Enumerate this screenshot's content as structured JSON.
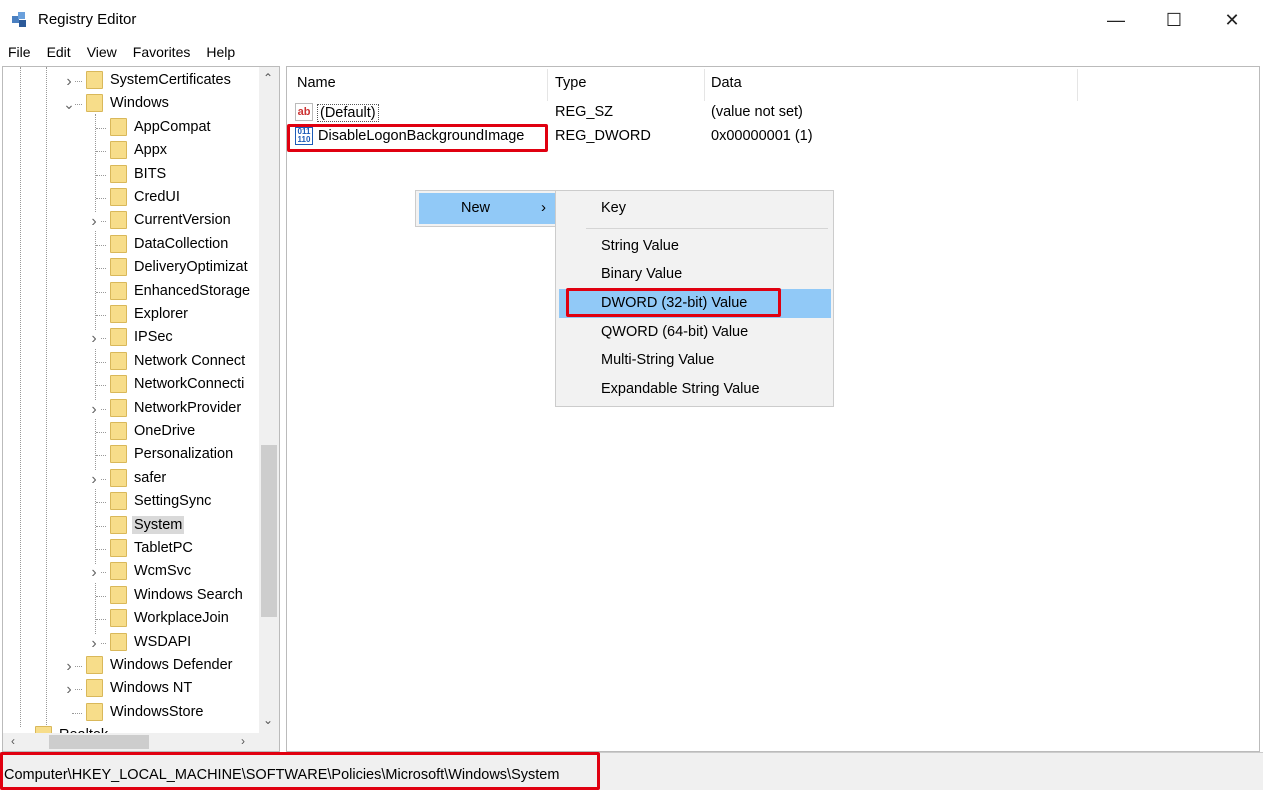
{
  "window": {
    "title": "Registry Editor",
    "minimize": "—",
    "maximize": "☐",
    "close": "✕"
  },
  "menu": [
    "File",
    "Edit",
    "View",
    "Favorites",
    "Help"
  ],
  "tree": {
    "items": [
      {
        "label": "SystemCertificates",
        "level": 1,
        "expander": "collapsed"
      },
      {
        "label": "Windows",
        "level": 1,
        "expander": "expanded"
      },
      {
        "label": "AppCompat",
        "level": 2
      },
      {
        "label": "Appx",
        "level": 2
      },
      {
        "label": "BITS",
        "level": 2
      },
      {
        "label": "CredUI",
        "level": 2
      },
      {
        "label": "CurrentVersion",
        "level": 2,
        "expander": "collapsed"
      },
      {
        "label": "DataCollection",
        "level": 2
      },
      {
        "label": "DeliveryOptimizat",
        "level": 2
      },
      {
        "label": "EnhancedStorage",
        "level": 2
      },
      {
        "label": "Explorer",
        "level": 2
      },
      {
        "label": "IPSec",
        "level": 2,
        "expander": "collapsed"
      },
      {
        "label": "Network Connect",
        "level": 2
      },
      {
        "label": "NetworkConnecti",
        "level": 2
      },
      {
        "label": "NetworkProvider",
        "level": 2,
        "expander": "collapsed"
      },
      {
        "label": "OneDrive",
        "level": 2
      },
      {
        "label": "Personalization",
        "level": 2
      },
      {
        "label": "safer",
        "level": 2,
        "expander": "collapsed"
      },
      {
        "label": "SettingSync",
        "level": 2
      },
      {
        "label": "System",
        "level": 2,
        "selected": true
      },
      {
        "label": "TabletPC",
        "level": 2
      },
      {
        "label": "WcmSvc",
        "level": 2,
        "expander": "collapsed"
      },
      {
        "label": "Windows Search",
        "level": 2
      },
      {
        "label": "WorkplaceJoin",
        "level": 2
      },
      {
        "label": "WSDAPI",
        "level": 2,
        "expander": "collapsed"
      },
      {
        "label": "Windows Defender",
        "level": 1,
        "expander": "collapsed"
      },
      {
        "label": "Windows NT",
        "level": 1,
        "expander": "collapsed"
      },
      {
        "label": "WindowsStore",
        "level": 1
      },
      {
        "label": "Realtek",
        "level": 0
      }
    ]
  },
  "list": {
    "columns": [
      "Name",
      "Type",
      "Data"
    ],
    "rows": [
      {
        "icon": "string-value-icon",
        "name": "(Default)",
        "type": "REG_SZ",
        "data": "(value not set)"
      },
      {
        "icon": "binary-value-icon",
        "name": "DisableLogonBackgroundImage",
        "type": "REG_DWORD",
        "data": "0x00000001 (1)"
      }
    ]
  },
  "context_menu": {
    "new_label": "New",
    "arrow": "›"
  },
  "submenu": {
    "items": [
      "Key",
      "String Value",
      "Binary Value",
      "DWORD (32-bit) Value",
      "QWORD (64-bit) Value",
      "Multi-String Value",
      "Expandable String Value"
    ],
    "highlighted": "DWORD (32-bit) Value"
  },
  "status": {
    "path": "Computer\\HKEY_LOCAL_MACHINE\\SOFTWARE\\Policies\\Microsoft\\Windows\\System"
  },
  "colors": {
    "highlight": "#91c9f7",
    "annotation": "#e00010",
    "folder": "#f7dd8a"
  }
}
